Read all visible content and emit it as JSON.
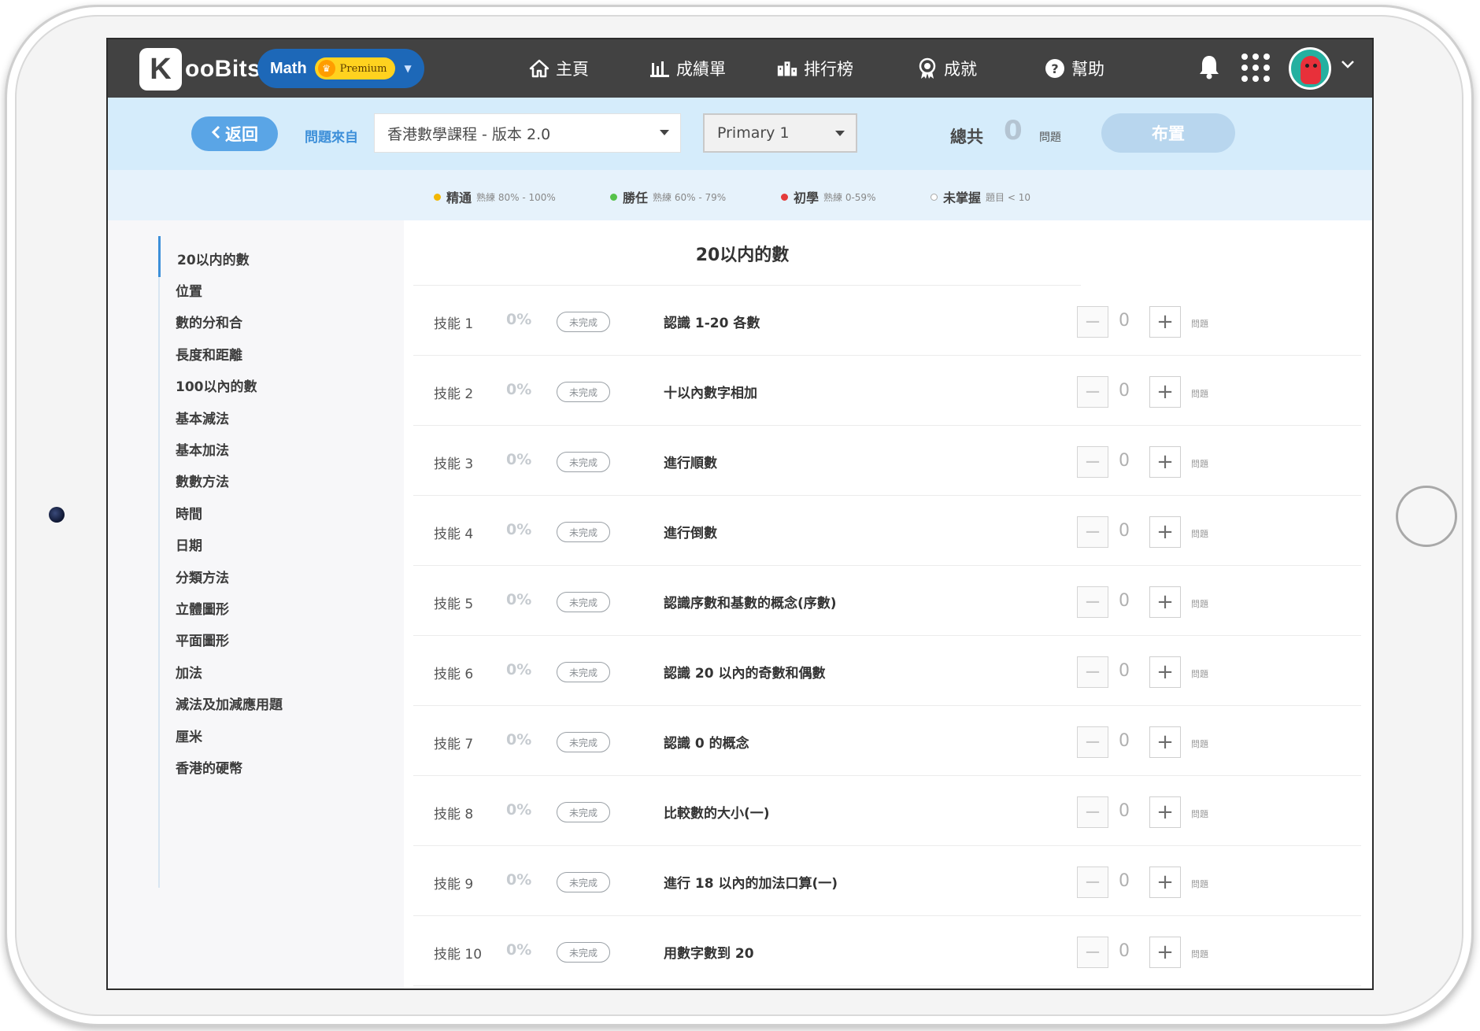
{
  "brand": {
    "logo_letter": "K",
    "logo_text": "ooBits"
  },
  "subject": {
    "name": "Math",
    "premium": "Premium"
  },
  "nav": {
    "home": "主頁",
    "report": "成績單",
    "rank": "排行榜",
    "achieve": "成就",
    "help": "幫助"
  },
  "filters": {
    "back": "返回",
    "source_label": "問題來自",
    "course": "香港數學課程 - 版本 2.0",
    "grade": "Primary 1",
    "total_label": "總共",
    "total_count": "0",
    "total_unit": "問題",
    "assign": "布置"
  },
  "legend": [
    {
      "name": "精通",
      "range": "熟練 80% - 100%",
      "color": "#f2b705"
    },
    {
      "name": "勝任",
      "range": "熟練 60% - 79%",
      "color": "#55c24a"
    },
    {
      "name": "初學",
      "range": "熟練 0-59%",
      "color": "#e43b3b"
    },
    {
      "name": "未掌握",
      "range": "題目 < 10",
      "color": "#ffffff"
    }
  ],
  "sidebar": {
    "items": [
      "20以内的數",
      "位置",
      "數的分和合",
      "長度和距離",
      "100以內的數",
      "基本減法",
      "基本加法",
      "數數方法",
      "時間",
      "日期",
      "分類方法",
      "立體圖形",
      "平面圖形",
      "加法",
      "減法及加減應用題",
      "厘米",
      "香港的硬幣"
    ]
  },
  "main": {
    "title": "20以内的數",
    "skills": [
      {
        "no": "技能 1",
        "pct": "0%",
        "status": "未完成",
        "name": "認識 1-20 各數",
        "count": "0",
        "unit": "問題"
      },
      {
        "no": "技能 2",
        "pct": "0%",
        "status": "未完成",
        "name": "十以內數字相加",
        "count": "0",
        "unit": "問題"
      },
      {
        "no": "技能 3",
        "pct": "0%",
        "status": "未完成",
        "name": "進行順數",
        "count": "0",
        "unit": "問題"
      },
      {
        "no": "技能 4",
        "pct": "0%",
        "status": "未完成",
        "name": "進行倒數",
        "count": "0",
        "unit": "問題"
      },
      {
        "no": "技能 5",
        "pct": "0%",
        "status": "未完成",
        "name": "認識序數和基數的概念(序數)",
        "count": "0",
        "unit": "問題"
      },
      {
        "no": "技能 6",
        "pct": "0%",
        "status": "未完成",
        "name": "認識 20 以內的奇數和偶數",
        "count": "0",
        "unit": "問題"
      },
      {
        "no": "技能 7",
        "pct": "0%",
        "status": "未完成",
        "name": "認識 0 的概念",
        "count": "0",
        "unit": "問題"
      },
      {
        "no": "技能 8",
        "pct": "0%",
        "status": "未完成",
        "name": "比較數的大小(一)",
        "count": "0",
        "unit": "問題"
      },
      {
        "no": "技能 9",
        "pct": "0%",
        "status": "未完成",
        "name": "進行 18 以內的加法口算(一)",
        "count": "0",
        "unit": "問題"
      },
      {
        "no": "技能 10",
        "pct": "0%",
        "status": "未完成",
        "name": "用數字數到 20",
        "count": "0",
        "unit": "問題"
      }
    ]
  },
  "colors": {
    "nav_bg": "#424242",
    "accent": "#3d8fd9",
    "filter_bg": "#d5ecfb"
  }
}
